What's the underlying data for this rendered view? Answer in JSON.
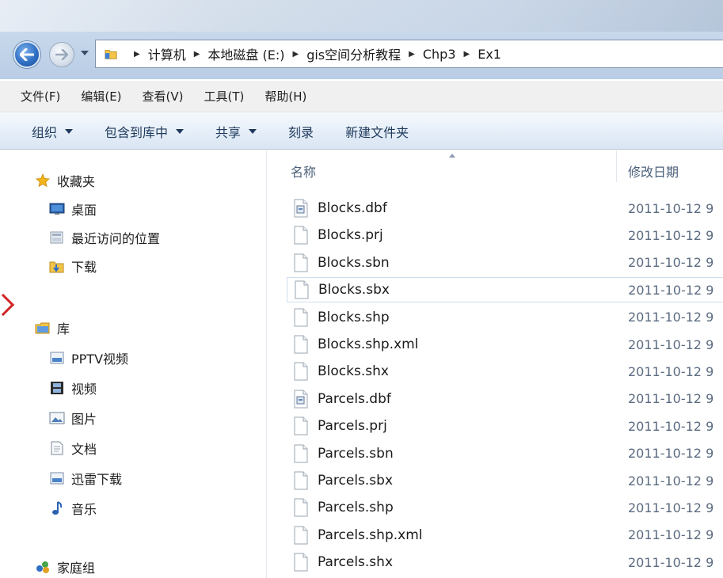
{
  "address": {
    "crumbs": [
      "计算机",
      "本地磁盘 (E:)",
      "gis空间分析教程",
      "Chp3",
      "Ex1"
    ]
  },
  "menubar": {
    "items": [
      "文件(F)",
      "编辑(E)",
      "查看(V)",
      "工具(T)",
      "帮助(H)"
    ]
  },
  "commandbar": {
    "organize": "组织",
    "include_library": "包含到库中",
    "share": "共享",
    "burn": "刻录",
    "new_folder": "新建文件夹"
  },
  "navpane": {
    "favorites": "收藏夹",
    "desktop": "桌面",
    "recent": "最近访问的位置",
    "downloads": "下载",
    "libraries": "库",
    "pptv": "PPTV视频",
    "videos": "视频",
    "pictures": "图片",
    "documents": "文档",
    "xunlei": "迅雷下载",
    "music": "音乐",
    "homegroup": "家庭组"
  },
  "columns": {
    "name": "名称",
    "modified": "修改日期"
  },
  "files": [
    {
      "name": "Blocks.dbf",
      "date": "2011-10-12 9",
      "icon": "dbf-file-icon"
    },
    {
      "name": "Blocks.prj",
      "date": "2011-10-12 9",
      "icon": "blank-file-icon"
    },
    {
      "name": "Blocks.sbn",
      "date": "2011-10-12 9",
      "icon": "blank-file-icon"
    },
    {
      "name": "Blocks.sbx",
      "date": "2011-10-12 9",
      "icon": "blank-file-icon"
    },
    {
      "name": "Blocks.shp",
      "date": "2011-10-12 9",
      "icon": "blank-file-icon"
    },
    {
      "name": "Blocks.shp.xml",
      "date": "2011-10-12 9",
      "icon": "blank-file-icon"
    },
    {
      "name": "Blocks.shx",
      "date": "2011-10-12 9",
      "icon": "blank-file-icon"
    },
    {
      "name": "Parcels.dbf",
      "date": "2011-10-12 9",
      "icon": "dbf-file-icon"
    },
    {
      "name": "Parcels.prj",
      "date": "2011-10-12 9",
      "icon": "blank-file-icon"
    },
    {
      "name": "Parcels.sbn",
      "date": "2011-10-12 9",
      "icon": "blank-file-icon"
    },
    {
      "name": "Parcels.sbx",
      "date": "2011-10-12 9",
      "icon": "blank-file-icon"
    },
    {
      "name": "Parcels.shp",
      "date": "2011-10-12 9",
      "icon": "blank-file-icon"
    },
    {
      "name": "Parcels.shp.xml",
      "date": "2011-10-12 9",
      "icon": "blank-file-icon"
    },
    {
      "name": "Parcels.shx",
      "date": "2011-10-12 9",
      "icon": "blank-file-icon"
    }
  ],
  "selected_file": "Blocks.sbx",
  "colors": {
    "accent": "#2f6fc4",
    "command_text": "#1e395b",
    "selection_border": "#cfdcec",
    "chevron": "#d12626"
  }
}
